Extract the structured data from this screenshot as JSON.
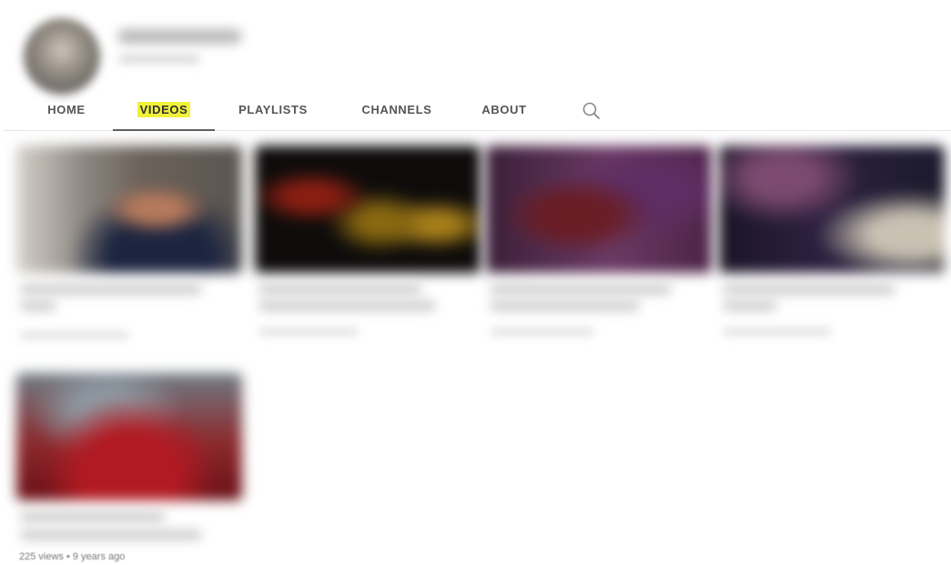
{
  "channel": {
    "avatar_icon": "channel-avatar"
  },
  "tabs": [
    {
      "label": "HOME",
      "active": false
    },
    {
      "label": "VIDEOS",
      "active": true
    },
    {
      "label": "PLAYLISTS",
      "active": false
    },
    {
      "label": "CHANNELS",
      "active": false
    },
    {
      "label": "ABOUT",
      "active": false
    }
  ],
  "search_icon": "search-icon",
  "colors": {
    "highlight": "#f0f23a",
    "active_underline": "#606060",
    "tab_text": "#555555"
  },
  "videos": [
    {
      "thumbnail_icon": "video-thumbnail"
    },
    {
      "thumbnail_icon": "video-thumbnail"
    },
    {
      "thumbnail_icon": "video-thumbnail"
    },
    {
      "thumbnail_icon": "video-thumbnail"
    },
    {
      "thumbnail_icon": "video-thumbnail"
    }
  ],
  "last_video_meta": "225 views • 9 years ago"
}
